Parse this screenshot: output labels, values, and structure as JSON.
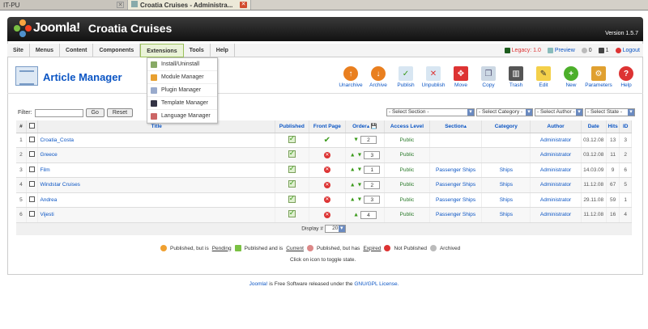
{
  "browser": {
    "tabs": [
      {
        "label": "IT-PU"
      },
      {
        "label": "Croatia Cruises - Administra..."
      }
    ]
  },
  "header": {
    "logo_text": "Joomla!",
    "site_name": "Croatia Cruises",
    "version": "Version 1.5.7"
  },
  "menu": {
    "items": [
      "Site",
      "Menus",
      "Content",
      "Components",
      "Extensions",
      "Tools",
      "Help"
    ],
    "right": {
      "legacy": "Legacy: 1.0",
      "preview": "Preview",
      "messages": "0",
      "users": "1",
      "logout": "Logout"
    },
    "extensions_dropdown": [
      "Install/Uninstall",
      "Module Manager",
      "Plugin Manager",
      "Template Manager",
      "Language Manager"
    ]
  },
  "page": {
    "title": "Article Manager"
  },
  "toolbar": {
    "buttons": [
      "Unarchive",
      "Archive",
      "Publish",
      "Unpublish",
      "Move",
      "Copy",
      "Trash",
      "Edit",
      "New",
      "Parameters",
      "Help"
    ]
  },
  "filter": {
    "label": "Filter:",
    "value": "",
    "go": "Go",
    "reset": "Reset",
    "selects": [
      "- Select Section -",
      "- Select Category -",
      "- Select Author -",
      "- Select State -"
    ]
  },
  "table": {
    "headers": {
      "num": "#",
      "title": "Title",
      "published": "Published",
      "frontpage": "Front Page",
      "order": "Order",
      "access": "Access Level",
      "section": "Section",
      "category": "Category",
      "author": "Author",
      "date": "Date",
      "hits": "Hits",
      "id": "ID"
    },
    "rows": [
      {
        "num": "1",
        "title": "Croatia_Costa",
        "frontpage": "yes",
        "order": "2",
        "access": "Public",
        "section": "",
        "category": "",
        "author": "Administrator",
        "date": "03.12.08",
        "hits": "13",
        "id": "3"
      },
      {
        "num": "2",
        "title": "Greece",
        "frontpage": "no",
        "order": "3",
        "access": "Public",
        "section": "",
        "category": "",
        "author": "Administrator",
        "date": "03.12.08",
        "hits": "11",
        "id": "2"
      },
      {
        "num": "3",
        "title": "Film",
        "frontpage": "no",
        "order": "1",
        "access": "Public",
        "section": "Passenger Ships",
        "category": "Ships",
        "author": "Administrator",
        "date": "14.03.09",
        "hits": "9",
        "id": "6"
      },
      {
        "num": "4",
        "title": "Windstar Cruises",
        "frontpage": "no",
        "order": "2",
        "access": "Public",
        "section": "Passenger Ships",
        "category": "Ships",
        "author": "Administrator",
        "date": "11.12.08",
        "hits": "67",
        "id": "5"
      },
      {
        "num": "5",
        "title": "Andrea",
        "frontpage": "no",
        "order": "3",
        "access": "Public",
        "section": "Passenger Ships",
        "category": "Ships",
        "author": "Administrator",
        "date": "29.11.08",
        "hits": "59",
        "id": "1"
      },
      {
        "num": "6",
        "title": "Vijesti",
        "frontpage": "no",
        "order": "4",
        "access": "Public",
        "section": "Passenger Ships",
        "category": "Ships",
        "author": "Administrator",
        "date": "11.12.08",
        "hits": "16",
        "id": "4"
      }
    ],
    "display_label": "Display #",
    "display_value": "20"
  },
  "legend": {
    "pending_pre": "Published, but is",
    "pending": "Pending",
    "current_pre": "Published and is",
    "current": "Current",
    "expired_pre": "Published, but has",
    "expired": "Expired",
    "not_published": "Not Published",
    "archived": "Archived",
    "toggle_note": "Click on icon to toggle state."
  },
  "footer": {
    "brand": "Joomla!",
    "text": "is Free Software released under the",
    "license": "GNU/GPL License."
  }
}
